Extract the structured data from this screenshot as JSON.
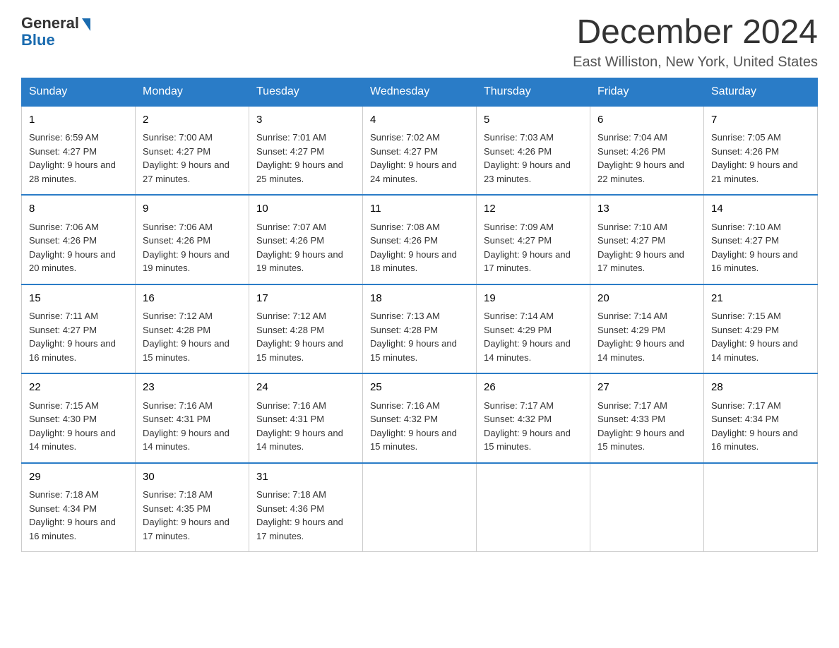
{
  "header": {
    "logo_general": "General",
    "logo_blue": "Blue",
    "month_title": "December 2024",
    "location": "East Williston, New York, United States"
  },
  "days_of_week": [
    "Sunday",
    "Monday",
    "Tuesday",
    "Wednesday",
    "Thursday",
    "Friday",
    "Saturday"
  ],
  "weeks": [
    [
      {
        "day": "1",
        "sunrise": "6:59 AM",
        "sunset": "4:27 PM",
        "daylight": "9 hours and 28 minutes."
      },
      {
        "day": "2",
        "sunrise": "7:00 AM",
        "sunset": "4:27 PM",
        "daylight": "9 hours and 27 minutes."
      },
      {
        "day": "3",
        "sunrise": "7:01 AM",
        "sunset": "4:27 PM",
        "daylight": "9 hours and 25 minutes."
      },
      {
        "day": "4",
        "sunrise": "7:02 AM",
        "sunset": "4:27 PM",
        "daylight": "9 hours and 24 minutes."
      },
      {
        "day": "5",
        "sunrise": "7:03 AM",
        "sunset": "4:26 PM",
        "daylight": "9 hours and 23 minutes."
      },
      {
        "day": "6",
        "sunrise": "7:04 AM",
        "sunset": "4:26 PM",
        "daylight": "9 hours and 22 minutes."
      },
      {
        "day": "7",
        "sunrise": "7:05 AM",
        "sunset": "4:26 PM",
        "daylight": "9 hours and 21 minutes."
      }
    ],
    [
      {
        "day": "8",
        "sunrise": "7:06 AM",
        "sunset": "4:26 PM",
        "daylight": "9 hours and 20 minutes."
      },
      {
        "day": "9",
        "sunrise": "7:06 AM",
        "sunset": "4:26 PM",
        "daylight": "9 hours and 19 minutes."
      },
      {
        "day": "10",
        "sunrise": "7:07 AM",
        "sunset": "4:26 PM",
        "daylight": "9 hours and 19 minutes."
      },
      {
        "day": "11",
        "sunrise": "7:08 AM",
        "sunset": "4:26 PM",
        "daylight": "9 hours and 18 minutes."
      },
      {
        "day": "12",
        "sunrise": "7:09 AM",
        "sunset": "4:27 PM",
        "daylight": "9 hours and 17 minutes."
      },
      {
        "day": "13",
        "sunrise": "7:10 AM",
        "sunset": "4:27 PM",
        "daylight": "9 hours and 17 minutes."
      },
      {
        "day": "14",
        "sunrise": "7:10 AM",
        "sunset": "4:27 PM",
        "daylight": "9 hours and 16 minutes."
      }
    ],
    [
      {
        "day": "15",
        "sunrise": "7:11 AM",
        "sunset": "4:27 PM",
        "daylight": "9 hours and 16 minutes."
      },
      {
        "day": "16",
        "sunrise": "7:12 AM",
        "sunset": "4:28 PM",
        "daylight": "9 hours and 15 minutes."
      },
      {
        "day": "17",
        "sunrise": "7:12 AM",
        "sunset": "4:28 PM",
        "daylight": "9 hours and 15 minutes."
      },
      {
        "day": "18",
        "sunrise": "7:13 AM",
        "sunset": "4:28 PM",
        "daylight": "9 hours and 15 minutes."
      },
      {
        "day": "19",
        "sunrise": "7:14 AM",
        "sunset": "4:29 PM",
        "daylight": "9 hours and 14 minutes."
      },
      {
        "day": "20",
        "sunrise": "7:14 AM",
        "sunset": "4:29 PM",
        "daylight": "9 hours and 14 minutes."
      },
      {
        "day": "21",
        "sunrise": "7:15 AM",
        "sunset": "4:29 PM",
        "daylight": "9 hours and 14 minutes."
      }
    ],
    [
      {
        "day": "22",
        "sunrise": "7:15 AM",
        "sunset": "4:30 PM",
        "daylight": "9 hours and 14 minutes."
      },
      {
        "day": "23",
        "sunrise": "7:16 AM",
        "sunset": "4:31 PM",
        "daylight": "9 hours and 14 minutes."
      },
      {
        "day": "24",
        "sunrise": "7:16 AM",
        "sunset": "4:31 PM",
        "daylight": "9 hours and 14 minutes."
      },
      {
        "day": "25",
        "sunrise": "7:16 AM",
        "sunset": "4:32 PM",
        "daylight": "9 hours and 15 minutes."
      },
      {
        "day": "26",
        "sunrise": "7:17 AM",
        "sunset": "4:32 PM",
        "daylight": "9 hours and 15 minutes."
      },
      {
        "day": "27",
        "sunrise": "7:17 AM",
        "sunset": "4:33 PM",
        "daylight": "9 hours and 15 minutes."
      },
      {
        "day": "28",
        "sunrise": "7:17 AM",
        "sunset": "4:34 PM",
        "daylight": "9 hours and 16 minutes."
      }
    ],
    [
      {
        "day": "29",
        "sunrise": "7:18 AM",
        "sunset": "4:34 PM",
        "daylight": "9 hours and 16 minutes."
      },
      {
        "day": "30",
        "sunrise": "7:18 AM",
        "sunset": "4:35 PM",
        "daylight": "9 hours and 17 minutes."
      },
      {
        "day": "31",
        "sunrise": "7:18 AM",
        "sunset": "4:36 PM",
        "daylight": "9 hours and 17 minutes."
      },
      null,
      null,
      null,
      null
    ]
  ]
}
